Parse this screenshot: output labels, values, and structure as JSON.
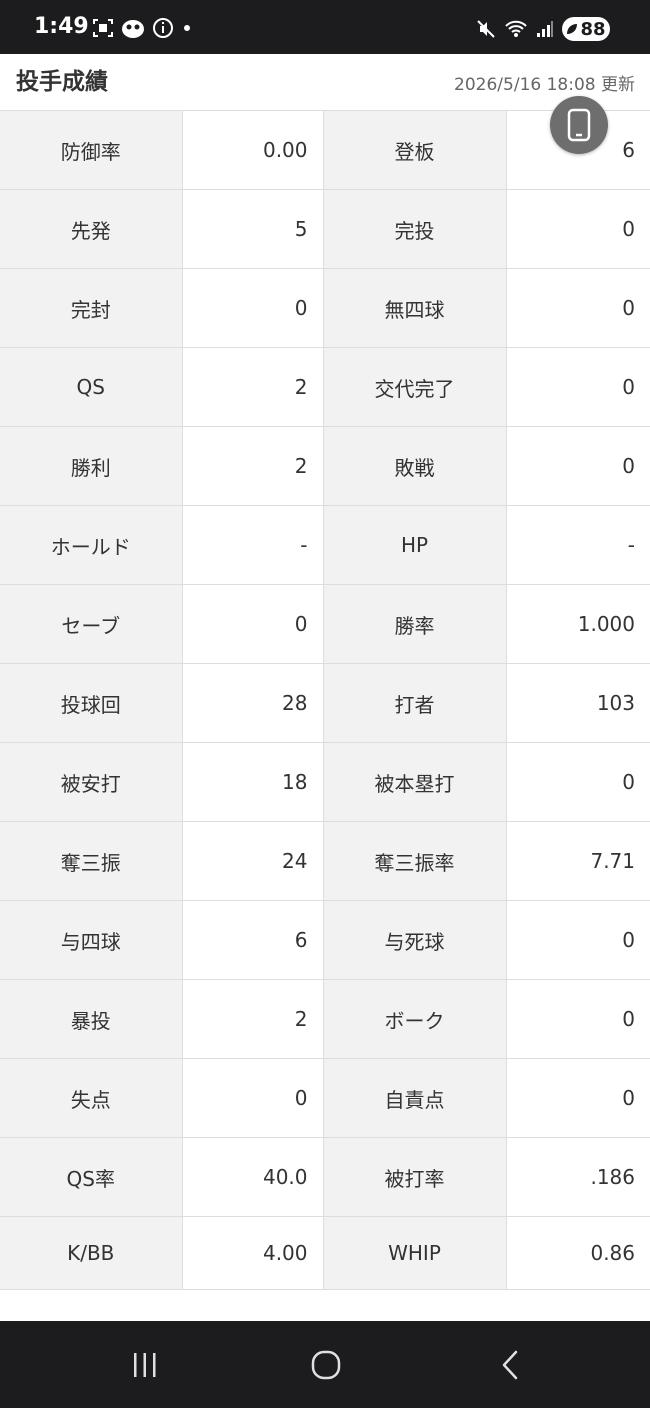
{
  "status_bar": {
    "time": "1:49",
    "battery": "88"
  },
  "header": {
    "title": "投手成績",
    "updated": "2026/5/16 18:08 更新"
  },
  "stats": [
    {
      "l1": "防御率",
      "v1": "0.00",
      "l2": "登板",
      "v2": "6"
    },
    {
      "l1": "先発",
      "v1": "5",
      "l2": "完投",
      "v2": "0"
    },
    {
      "l1": "完封",
      "v1": "0",
      "l2": "無四球",
      "v2": "0"
    },
    {
      "l1": "QS",
      "v1": "2",
      "l2": "交代完了",
      "v2": "0"
    },
    {
      "l1": "勝利",
      "v1": "2",
      "l2": "敗戦",
      "v2": "0"
    },
    {
      "l1": "ホールド",
      "v1": "-",
      "l2": "HP",
      "v2": "-"
    },
    {
      "l1": "セーブ",
      "v1": "0",
      "l2": "勝率",
      "v2": "1.000"
    },
    {
      "l1": "投球回",
      "v1": "28",
      "l2": "打者",
      "v2": "103"
    },
    {
      "l1": "被安打",
      "v1": "18",
      "l2": "被本塁打",
      "v2": "0"
    },
    {
      "l1": "奪三振",
      "v1": "24",
      "l2": "奪三振率",
      "v2": "7.71"
    },
    {
      "l1": "与四球",
      "v1": "6",
      "l2": "与死球",
      "v2": "0"
    },
    {
      "l1": "暴投",
      "v1": "2",
      "l2": "ボーク",
      "v2": "0"
    },
    {
      "l1": "失点",
      "v1": "0",
      "l2": "自責点",
      "v2": "0"
    },
    {
      "l1": "QS率",
      "v1": "40.0",
      "l2": "被打率",
      "v2": ".186"
    },
    {
      "l1": "K/BB",
      "v1": "4.00",
      "l2": "WHIP",
      "v2": "0.86"
    }
  ],
  "icons": {
    "float_button": "phone-icon",
    "nav_recent": "recent-apps-icon",
    "nav_home": "home-icon",
    "nav_back": "back-icon"
  },
  "colors": {
    "status_bar_bg": "#1c1c1e",
    "label_cell_bg": "#f2f2f2",
    "float_button_bg": "#6e6e6e"
  }
}
